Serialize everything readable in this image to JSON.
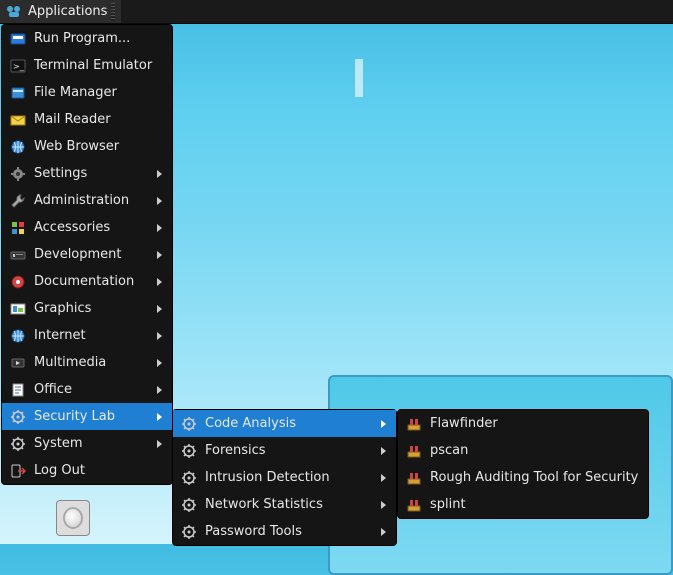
{
  "panel": {
    "app_button_label": "Applications"
  },
  "menu": {
    "root": [
      {
        "label": "Run Program...",
        "submenu": false,
        "icon": "run"
      },
      {
        "label": "Terminal Emulator",
        "submenu": false,
        "icon": "terminal"
      },
      {
        "label": "File Manager",
        "submenu": false,
        "icon": "files"
      },
      {
        "label": "Mail Reader",
        "submenu": false,
        "icon": "mail"
      },
      {
        "label": "Web Browser",
        "submenu": false,
        "icon": "globe"
      },
      {
        "label": "Settings",
        "submenu": true,
        "icon": "gear"
      },
      {
        "label": "Administration",
        "submenu": true,
        "icon": "wrench"
      },
      {
        "label": "Accessories",
        "submenu": true,
        "icon": "accessories"
      },
      {
        "label": "Development",
        "submenu": true,
        "icon": "dev"
      },
      {
        "label": "Documentation",
        "submenu": true,
        "icon": "docs"
      },
      {
        "label": "Graphics",
        "submenu": true,
        "icon": "graphics"
      },
      {
        "label": "Internet",
        "submenu": true,
        "icon": "globe"
      },
      {
        "label": "Multimedia",
        "submenu": true,
        "icon": "media"
      },
      {
        "label": "Office",
        "submenu": true,
        "icon": "office"
      },
      {
        "label": "Security Lab",
        "submenu": true,
        "icon": "gear-light",
        "selected": true
      },
      {
        "label": "System",
        "submenu": true,
        "icon": "gear-light"
      },
      {
        "label": "Log Out",
        "submenu": false,
        "icon": "logout"
      }
    ],
    "sub1": [
      {
        "label": "Code Analysis",
        "submenu": true,
        "icon": "gear-light",
        "selected": true
      },
      {
        "label": "Forensics",
        "submenu": true,
        "icon": "gear-light"
      },
      {
        "label": "Intrusion Detection",
        "submenu": true,
        "icon": "gear-light"
      },
      {
        "label": "Network Statistics",
        "submenu": true,
        "icon": "gear-light"
      },
      {
        "label": "Password Tools",
        "submenu": true,
        "icon": "gear-light"
      }
    ],
    "sub2": [
      {
        "label": "Flawfinder",
        "submenu": false,
        "icon": "tool"
      },
      {
        "label": "pscan",
        "submenu": false,
        "icon": "tool"
      },
      {
        "label": "Rough Auditing Tool for Security",
        "submenu": false,
        "icon": "tool"
      },
      {
        "label": "splint",
        "submenu": false,
        "icon": "tool"
      }
    ]
  }
}
